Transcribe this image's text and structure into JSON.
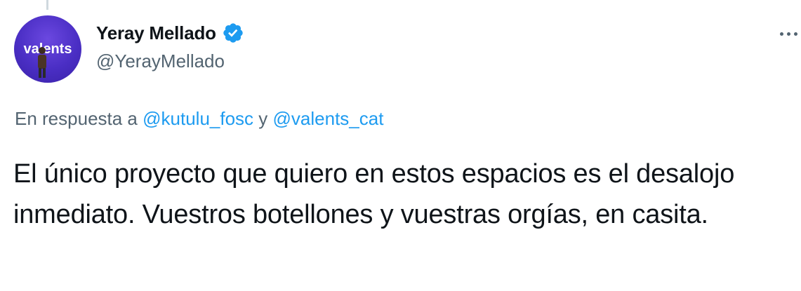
{
  "author": {
    "display_name": "Yeray Mellado",
    "handle": "@YerayMellado",
    "verified": true,
    "avatar_text": "valents"
  },
  "reply": {
    "prefix": "En respuesta a",
    "mention_1": "@kutulu_fosc",
    "conjunction": "y",
    "mention_2": "@valents_cat"
  },
  "tweet": {
    "text": "El único proyecto que quiero en estos espacios es el desalojo inmediato. Vuestros botellones y vuestras orgías, en casita."
  },
  "icons": {
    "verified": "verified-badge-icon",
    "more": "more-options-icon"
  },
  "colors": {
    "text_primary": "#0f1419",
    "text_secondary": "#536471",
    "link": "#1d9bf0",
    "verified": "#1d9bf0",
    "avatar_bg": "#4a2ec4"
  }
}
